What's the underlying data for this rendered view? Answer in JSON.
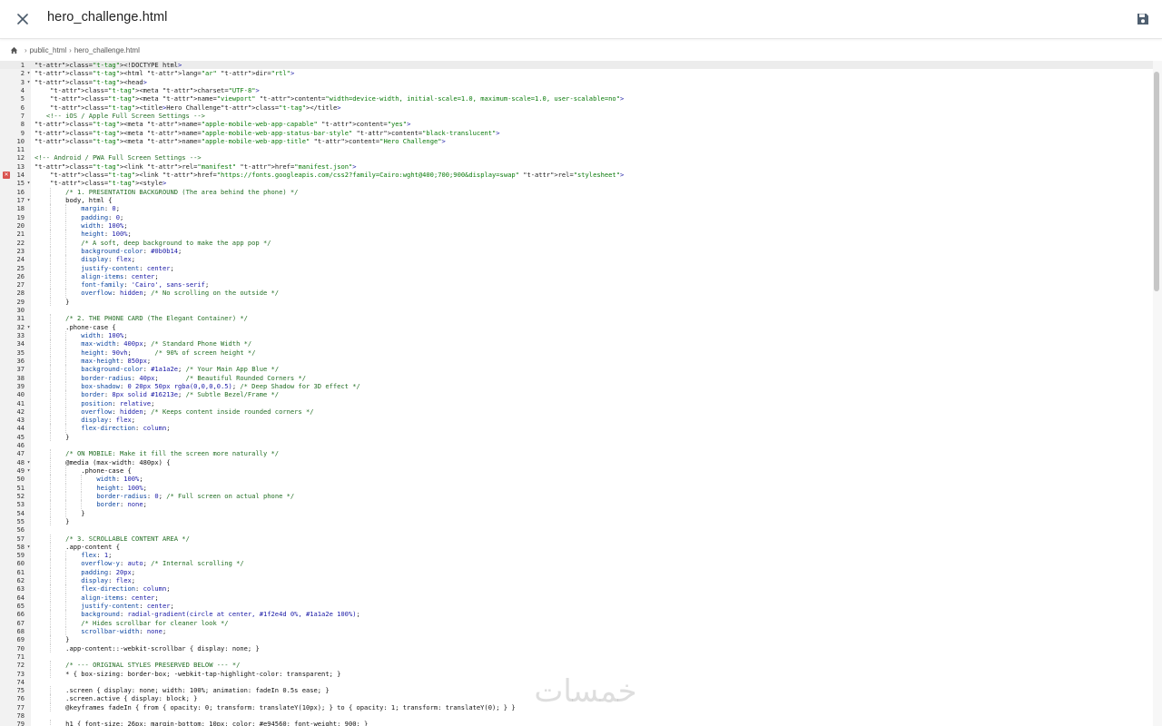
{
  "header": {
    "title": "hero_challenge.html",
    "close_icon": "close-icon",
    "save_icon": "save-icon"
  },
  "breadcrumb": {
    "home_icon": "home-icon",
    "items": [
      "public_html",
      "hero_challenge.html"
    ]
  },
  "editor": {
    "active_line": 1,
    "error_line": 14,
    "lines": [
      {
        "n": 1,
        "fold": false,
        "text": "<!DOCTYPE html>"
      },
      {
        "n": 2,
        "fold": true,
        "text": "<html lang=\"ar\" dir=\"rtl\">"
      },
      {
        "n": 3,
        "fold": true,
        "text": "<head>"
      },
      {
        "n": 4,
        "fold": false,
        "text": "    <meta charset=\"UTF-8\">"
      },
      {
        "n": 5,
        "fold": false,
        "text": "    <meta name=\"viewport\" content=\"width=device-width, initial-scale=1.0, maximum-scale=1.0, user-scalable=no\">"
      },
      {
        "n": 6,
        "fold": false,
        "text": "    <title>Hero Challenge</title>"
      },
      {
        "n": 7,
        "fold": false,
        "text": "   <!-- iOS / Apple Full Screen Settings -->"
      },
      {
        "n": 8,
        "fold": false,
        "text": "<meta name=\"apple-mobile-web-app-capable\" content=\"yes\">"
      },
      {
        "n": 9,
        "fold": false,
        "text": "<meta name=\"apple-mobile-web-app-status-bar-style\" content=\"black-translucent\">"
      },
      {
        "n": 10,
        "fold": false,
        "text": "<meta name=\"apple-mobile-web-app-title\" content=\"Hero Challenge\">"
      },
      {
        "n": 11,
        "fold": false,
        "text": ""
      },
      {
        "n": 12,
        "fold": false,
        "text": "<!-- Android / PWA Full Screen Settings -->"
      },
      {
        "n": 13,
        "fold": false,
        "text": "<link rel=\"manifest\" href=\"manifest.json\">"
      },
      {
        "n": 14,
        "fold": false,
        "text": "    <link href=\"https://fonts.googleapis.com/css2?family=Cairo:wght@400;700;900&display=swap\" rel=\"stylesheet\">"
      },
      {
        "n": 15,
        "fold": true,
        "text": "    <style>"
      },
      {
        "n": 16,
        "fold": false,
        "text": "        /* 1. PRESENTATION BACKGROUND (The area behind the phone) */"
      },
      {
        "n": 17,
        "fold": true,
        "text": "        body, html {"
      },
      {
        "n": 18,
        "fold": false,
        "text": "            margin: 0;"
      },
      {
        "n": 19,
        "fold": false,
        "text": "            padding: 0;"
      },
      {
        "n": 20,
        "fold": false,
        "text": "            width: 100%;"
      },
      {
        "n": 21,
        "fold": false,
        "text": "            height: 100%;"
      },
      {
        "n": 22,
        "fold": false,
        "text": "            /* A soft, deep background to make the app pop */"
      },
      {
        "n": 23,
        "fold": false,
        "text": "            background-color: #0b0b14;"
      },
      {
        "n": 24,
        "fold": false,
        "text": "            display: flex;"
      },
      {
        "n": 25,
        "fold": false,
        "text": "            justify-content: center;"
      },
      {
        "n": 26,
        "fold": false,
        "text": "            align-items: center;"
      },
      {
        "n": 27,
        "fold": false,
        "text": "            font-family: 'Cairo', sans-serif;"
      },
      {
        "n": 28,
        "fold": false,
        "text": "            overflow: hidden; /* No scrolling on the outside */"
      },
      {
        "n": 29,
        "fold": false,
        "text": "        }"
      },
      {
        "n": 30,
        "fold": false,
        "text": ""
      },
      {
        "n": 31,
        "fold": false,
        "text": "        /* 2. THE PHONE CARD (The Elegant Container) */"
      },
      {
        "n": 32,
        "fold": true,
        "text": "        .phone-case {"
      },
      {
        "n": 33,
        "fold": false,
        "text": "            width: 100%;"
      },
      {
        "n": 34,
        "fold": false,
        "text": "            max-width: 400px; /* Standard Phone Width */"
      },
      {
        "n": 35,
        "fold": false,
        "text": "            height: 90vh;      /* 90% of screen height */"
      },
      {
        "n": 36,
        "fold": false,
        "text": "            max-height: 850px;"
      },
      {
        "n": 37,
        "fold": false,
        "text": "            background-color: #1a1a2e; /* Your Main App Blue */"
      },
      {
        "n": 38,
        "fold": false,
        "text": "            border-radius: 40px;       /* Beautiful Rounded Corners */"
      },
      {
        "n": 39,
        "fold": false,
        "text": "            box-shadow: 0 20px 50px rgba(0,0,0,0.5); /* Deep Shadow for 3D effect */"
      },
      {
        "n": 40,
        "fold": false,
        "text": "            border: 8px solid #16213e; /* Subtle Bezel/Frame */"
      },
      {
        "n": 41,
        "fold": false,
        "text": "            position: relative;"
      },
      {
        "n": 42,
        "fold": false,
        "text": "            overflow: hidden; /* Keeps content inside rounded corners */"
      },
      {
        "n": 43,
        "fold": false,
        "text": "            display: flex;"
      },
      {
        "n": 44,
        "fold": false,
        "text": "            flex-direction: column;"
      },
      {
        "n": 45,
        "fold": false,
        "text": "        }"
      },
      {
        "n": 46,
        "fold": false,
        "text": ""
      },
      {
        "n": 47,
        "fold": false,
        "text": "        /* ON MOBILE: Make it fill the screen more naturally */"
      },
      {
        "n": 48,
        "fold": true,
        "text": "        @media (max-width: 480px) {"
      },
      {
        "n": 49,
        "fold": true,
        "text": "            .phone-case {"
      },
      {
        "n": 50,
        "fold": false,
        "text": "                width: 100%;"
      },
      {
        "n": 51,
        "fold": false,
        "text": "                height: 100%;"
      },
      {
        "n": 52,
        "fold": false,
        "text": "                border-radius: 0; /* Full screen on actual phone */"
      },
      {
        "n": 53,
        "fold": false,
        "text": "                border: none;"
      },
      {
        "n": 54,
        "fold": false,
        "text": "            }"
      },
      {
        "n": 55,
        "fold": false,
        "text": "        }"
      },
      {
        "n": 56,
        "fold": false,
        "text": ""
      },
      {
        "n": 57,
        "fold": false,
        "text": "        /* 3. SCROLLABLE CONTENT AREA */"
      },
      {
        "n": 58,
        "fold": true,
        "text": "        .app-content {"
      },
      {
        "n": 59,
        "fold": false,
        "text": "            flex: 1;"
      },
      {
        "n": 60,
        "fold": false,
        "text": "            overflow-y: auto; /* Internal scrolling */"
      },
      {
        "n": 61,
        "fold": false,
        "text": "            padding: 20px;"
      },
      {
        "n": 62,
        "fold": false,
        "text": "            display: flex;"
      },
      {
        "n": 63,
        "fold": false,
        "text": "            flex-direction: column;"
      },
      {
        "n": 64,
        "fold": false,
        "text": "            align-items: center;"
      },
      {
        "n": 65,
        "fold": false,
        "text": "            justify-content: center;"
      },
      {
        "n": 66,
        "fold": false,
        "text": "            background: radial-gradient(circle at center, #1f2e4d 0%, #1a1a2e 100%);"
      },
      {
        "n": 67,
        "fold": false,
        "text": "            /* Hides scrollbar for cleaner look */"
      },
      {
        "n": 68,
        "fold": false,
        "text": "            scrollbar-width: none;"
      },
      {
        "n": 69,
        "fold": false,
        "text": "        }"
      },
      {
        "n": 70,
        "fold": false,
        "text": "        .app-content::-webkit-scrollbar { display: none; }"
      },
      {
        "n": 71,
        "fold": false,
        "text": ""
      },
      {
        "n": 72,
        "fold": false,
        "text": "        /* --- ORIGINAL STYLES PRESERVED BELOW --- */"
      },
      {
        "n": 73,
        "fold": false,
        "text": "        * { box-sizing: border-box; -webkit-tap-highlight-color: transparent; }"
      },
      {
        "n": 74,
        "fold": false,
        "text": ""
      },
      {
        "n": 75,
        "fold": false,
        "text": "        .screen { display: none; width: 100%; animation: fadeIn 0.5s ease; }"
      },
      {
        "n": 76,
        "fold": false,
        "text": "        .screen.active { display: block; }"
      },
      {
        "n": 77,
        "fold": false,
        "text": "        @keyframes fadeIn { from { opacity: 0; transform: translateY(10px); } to { opacity: 1; transform: translateY(0); } }"
      },
      {
        "n": 78,
        "fold": false,
        "text": ""
      },
      {
        "n": 79,
        "fold": false,
        "text": "        h1 { font-size: 26px; margin-bottom: 10px; color: #e94560; font-weight: 900; }"
      }
    ]
  },
  "watermark": {
    "text": "خمسات"
  }
}
